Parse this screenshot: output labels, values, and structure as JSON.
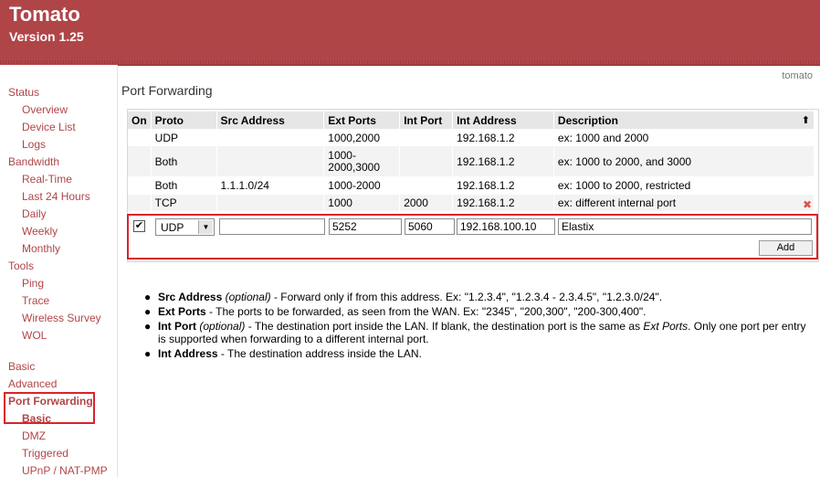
{
  "header": {
    "title": "Tomato",
    "version": "Version 1.25",
    "hostname": "tomato",
    "color": "#b04548"
  },
  "sidebar": {
    "items": [
      {
        "label": "Status"
      },
      {
        "label": "Overview"
      },
      {
        "label": "Device List"
      },
      {
        "label": "Logs"
      },
      {
        "label": "Bandwidth"
      },
      {
        "label": "Real-Time"
      },
      {
        "label": "Last 24 Hours"
      },
      {
        "label": "Daily"
      },
      {
        "label": "Weekly"
      },
      {
        "label": "Monthly"
      },
      {
        "label": "Tools"
      },
      {
        "label": "Ping"
      },
      {
        "label": "Trace"
      },
      {
        "label": "Wireless Survey"
      },
      {
        "label": "WOL"
      },
      {
        "label": "Basic"
      },
      {
        "label": "Advanced"
      },
      {
        "label": "Port Forwarding"
      },
      {
        "label": "Basic"
      },
      {
        "label": "DMZ"
      },
      {
        "label": "Triggered"
      },
      {
        "label": "UPnP / NAT-PMP"
      }
    ]
  },
  "main": {
    "page_title": "Port Forwarding",
    "columns": [
      "On",
      "Proto",
      "Src Address",
      "Ext Ports",
      "Int Port",
      "Int Address",
      "Description"
    ],
    "rows": [
      {
        "on": "",
        "proto": "UDP",
        "src": "",
        "ext": "1000,2000",
        "int_port": "",
        "int_addr": "192.168.1.2",
        "desc": "ex: 1000 and 2000"
      },
      {
        "on": "",
        "proto": "Both",
        "src": "",
        "ext": "1000-2000,3000",
        "int_port": "",
        "int_addr": "192.168.1.2",
        "desc": "ex: 1000 to 2000, and 3000"
      },
      {
        "on": "",
        "proto": "Both",
        "src": "1.1.1.0/24",
        "ext": "1000-2000",
        "int_port": "",
        "int_addr": "192.168.1.2",
        "desc": "ex: 1000 to 2000, restricted"
      },
      {
        "on": "",
        "proto": "TCP",
        "src": "",
        "ext": "1000",
        "int_port": "2000",
        "int_addr": "192.168.1.2",
        "desc": "ex: different internal port"
      }
    ],
    "delete_glyph": "✖",
    "sort_glyph": "⬆",
    "edit": {
      "checked_glyph": "✔",
      "proto": "UDP",
      "src": "",
      "ext": "5252",
      "int_port": "5060",
      "int_addr": "192.168.100.10",
      "desc": "Elastix",
      "add_label": "Add",
      "select_arrow": "▼"
    }
  },
  "notes": [
    {
      "term": "Src Address",
      "qual": "(optional)",
      "text": " - Forward only if from this address. Ex: \"1.2.3.4\", \"1.2.3.4 - 2.3.4.5\", \"1.2.3.0/24\"."
    },
    {
      "term": "Ext Ports",
      "qual": "",
      "text": " - The ports to be forwarded, as seen from the WAN. Ex: \"2345\", \"200,300\", \"200-300,400\"."
    },
    {
      "term": "Int Port",
      "qual": "(optional)",
      "text_a": " - The destination port inside the LAN. If blank, the destination port is the same as ",
      "em": "Ext Ports",
      "text_b": ". Only one port per entry is supported when forwarding to a different internal port."
    },
    {
      "term": "Int Address",
      "qual": "",
      "text": " - The destination address inside the LAN."
    }
  ],
  "bullet": "●"
}
